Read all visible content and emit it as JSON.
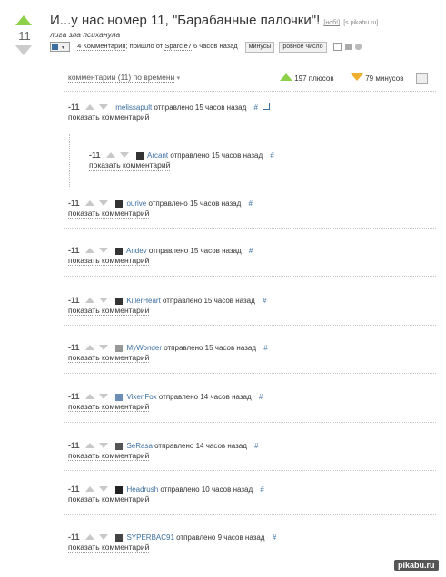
{
  "post": {
    "rating": "11",
    "title": "И...у нас номер 11, \"Барабанные палочки\"!",
    "source_label": "[ноб!]",
    "source_link": "[s.pikabu.ru]",
    "subtitle": "лига зла психанула",
    "comments_link": "4 Комментария",
    "posted_prefix": "; пришло от",
    "author": "Sparcle7",
    "posted_time": "6 часов назад",
    "tag1": "минусы",
    "tag2": "ровное число",
    "icons": [
      "save-icon",
      "vk-icon",
      "twitter-icon"
    ]
  },
  "comments_header": {
    "label": "комментарии (11) по времени",
    "plus_count": "197 плюсов",
    "minus_count": "79 минусов"
  },
  "comment_common": {
    "sent_text": "отправлено",
    "show_label": "показать комментарий",
    "hash": "#"
  },
  "comments": [
    {
      "rating": "-11",
      "author": "melissapult",
      "time": "15 часов назад"
    },
    {
      "rating": "-11",
      "author": "Arcant",
      "time": "15 часов назад"
    },
    {
      "rating": "-11",
      "author": "ourive",
      "time": "15 часов назад"
    },
    {
      "rating": "-11",
      "author": "Andev",
      "time": "15 часов назад"
    },
    {
      "rating": "-11",
      "author": "KillerHeart",
      "time": "15 часов назад"
    },
    {
      "rating": "-11",
      "author": "MyWonder",
      "time": "15 часов назад"
    },
    {
      "rating": "-11",
      "author": "VixenFox",
      "time": "14 часов назад"
    },
    {
      "rating": "-11",
      "author": "SeRasa",
      "time": "14 часов назад"
    },
    {
      "rating": "-11",
      "author": "Headrush",
      "time": "10 часов назад"
    },
    {
      "rating": "-11",
      "author": "SYPERBAC91",
      "time": "9 часов назад"
    }
  ],
  "watermark": "pikabu.ru",
  "colors": {
    "plus": "#8dd04a",
    "minus": "#f0b030",
    "link": "#3b6fa0"
  }
}
